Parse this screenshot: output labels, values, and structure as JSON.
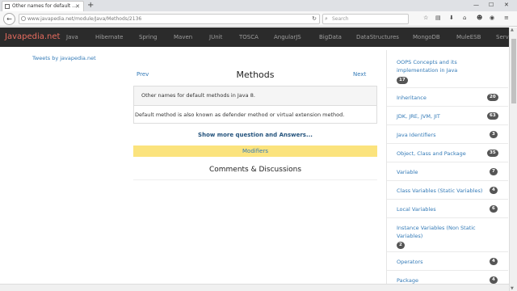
{
  "browser": {
    "tab_title": "Other names for default ...",
    "new_tab_label": "+",
    "url": "www.javapedia.net/module/Java/Methods/2136",
    "search_placeholder": "Search",
    "win_min": "—",
    "win_max": "☐",
    "win_close": "✕"
  },
  "site": {
    "brand": "Javapedia.net",
    "nav": [
      "Java",
      "Hibernate",
      "Spring",
      "Maven",
      "JUnit",
      "TOSCA",
      "AngularJS",
      "BigData",
      "DataStructures",
      "MongoDB",
      "MuleESB",
      "Servi"
    ]
  },
  "left": {
    "tweets": "Tweets by javapedia.net"
  },
  "main": {
    "prev": "Prev",
    "next": "Next",
    "title": "Methods",
    "question": "Other names for default methods in Java 8.",
    "answer": "Default method is also known as defender method or virtual extension method.",
    "show_more": "Show more question and Answers...",
    "modifiers": "Modifiers",
    "comments": "Comments & Discussions"
  },
  "sidebar": {
    "items": [
      {
        "label": "OOPS Concepts and its implementation in Java",
        "count": "17"
      },
      {
        "label": "Inheritance",
        "count": "20"
      },
      {
        "label": "JDK, JRE, JVM, JIT",
        "count": "63"
      },
      {
        "label": "Java Identifiers",
        "count": "3"
      },
      {
        "label": "Object, Class and Package",
        "count": "35"
      },
      {
        "label": "Variable",
        "count": "7"
      },
      {
        "label": "Class Variables (Static Variables)",
        "count": "4"
      },
      {
        "label": "Local Variables",
        "count": "6"
      },
      {
        "label": "Instance Variables (Non Static Variables)",
        "count": "2"
      },
      {
        "label": "Operators",
        "count": "4"
      },
      {
        "label": "Package",
        "count": "4"
      }
    ]
  },
  "colors": {
    "nav_bg": "#2b2b2b",
    "brand": "#e86c5f",
    "link": "#337ab7",
    "modifiers_bg": "#fbe37d",
    "badge_bg": "#555555"
  }
}
